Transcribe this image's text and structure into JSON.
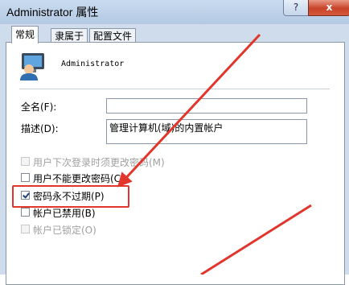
{
  "window": {
    "title": "Administrator 属性",
    "help_icon": "?",
    "close_icon": "x"
  },
  "tabs": [
    {
      "label": "常规"
    },
    {
      "label": "隶属于"
    },
    {
      "label": "配置文件"
    }
  ],
  "user": {
    "name": "Administrator",
    "icon": "user-icon"
  },
  "form": {
    "fullname_label": "全名(F):",
    "fullname_value": "",
    "description_label": "描述(D):",
    "description_value": "管理计算机(域)的内置帐户"
  },
  "options": [
    {
      "label": "用户下次登录时须更改密码(M)",
      "checked": false,
      "enabled": false
    },
    {
      "label": "用户不能更改密码(C)",
      "checked": false,
      "enabled": true
    },
    {
      "label": "密码永不过期(P)",
      "checked": true,
      "enabled": true
    },
    {
      "label": "帐户已禁用(B)",
      "checked": false,
      "enabled": true
    },
    {
      "label": "帐户已锁定(O)",
      "checked": false,
      "enabled": false
    }
  ],
  "colors": {
    "annotation": "#e2352b"
  }
}
